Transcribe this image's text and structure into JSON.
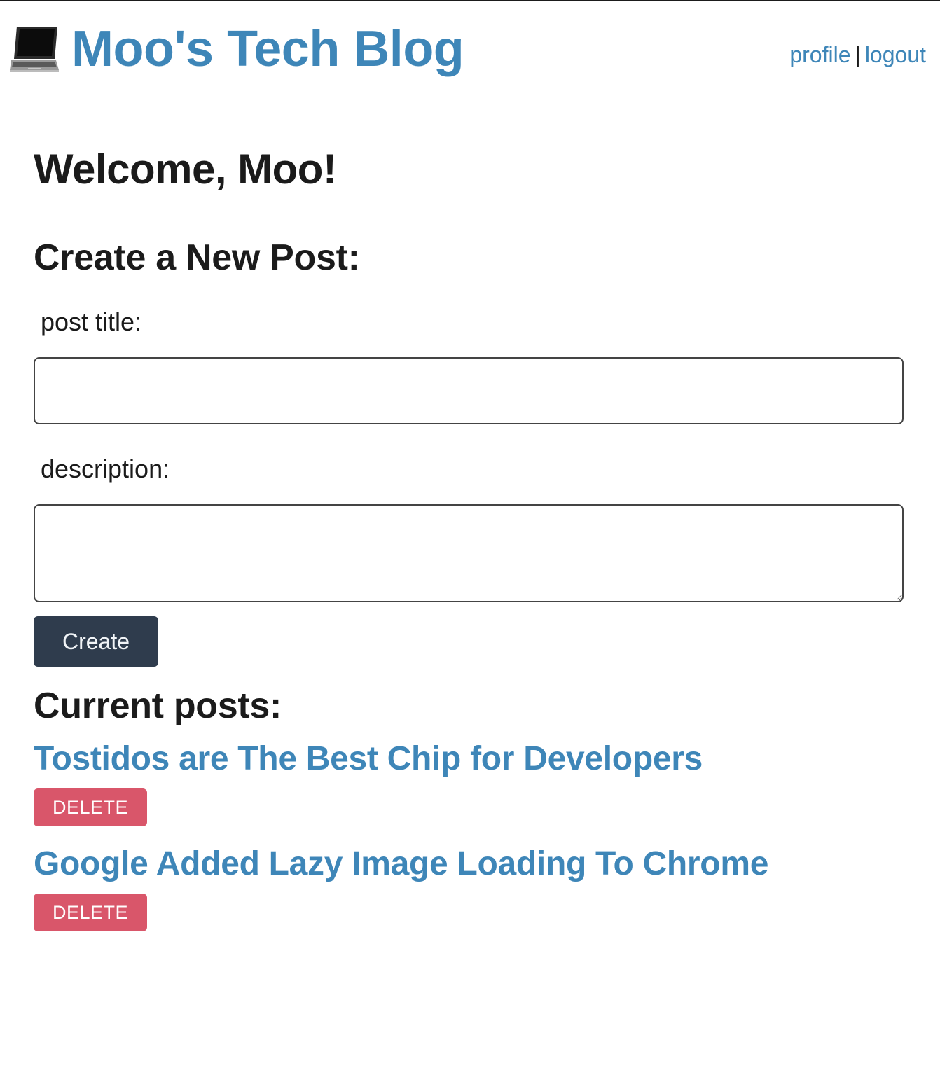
{
  "header": {
    "logo_icon": "laptop-icon",
    "site_title": "Moo's Tech Blog",
    "nav": {
      "profile_label": "profile",
      "separator": "|",
      "logout_label": "logout"
    }
  },
  "main": {
    "welcome_heading": "Welcome, Moo!",
    "create_form": {
      "heading": "Create a New Post:",
      "title_label": "post title:",
      "title_value": "",
      "description_label": "description:",
      "description_value": "",
      "submit_label": "Create"
    },
    "posts": {
      "heading": "Current posts:",
      "items": [
        {
          "title": "Tostidos are The Best Chip for Developers",
          "delete_label": "DELETE"
        },
        {
          "title": "Google Added Lazy Image Loading To Chrome",
          "delete_label": "DELETE"
        }
      ]
    }
  },
  "colors": {
    "link": "#3e86b8",
    "heading_text": "#1b1b1b",
    "create_button_bg": "#2f3c4d",
    "delete_button_bg": "#d9566a"
  }
}
